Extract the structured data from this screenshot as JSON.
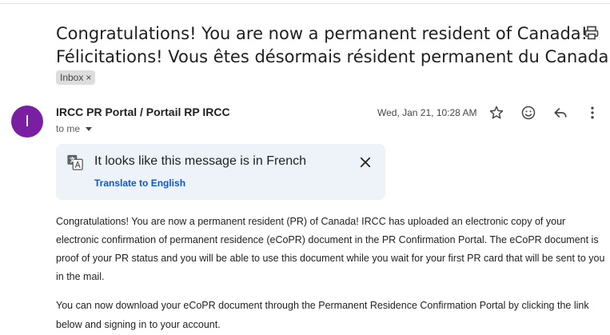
{
  "email": {
    "subject_en": "Congratulations! You are now a permanent resident of Canada!",
    "subject_fr": "Félicitations! Vous êtes désormais résident permanent du Canada!",
    "label": "Inbox",
    "label_remove": "×",
    "sender": {
      "initial": "I",
      "name": "IRCC PR Portal / Portail RP IRCC",
      "avatar_color": "#7b1fa2"
    },
    "recipient_line": "to me",
    "date": "Wed, Jan 21, 10:28 AM"
  },
  "toolbar_icons": [
    "print-icon",
    "star-icon",
    "emoji-icon",
    "reply-icon",
    "more-icon"
  ],
  "translate_banner": {
    "message": "It looks like this message is in French",
    "action": "Translate to English",
    "link_color": "#0b57d0"
  },
  "body": {
    "paragraphs": [
      "Congratulations! You are now a permanent resident (PR) of Canada! IRCC has uploaded an electronic copy of your electronic confirmation of permanent residence (eCoPR) document in the PR Confirmation Portal. The eCoPR document is proof of your PR status and you will be able to use this document while you wait for your first PR card that will be sent to you in the mail.",
      "You can now download your eCoPR document through the Permanent Residence Confirmation Portal by clicking the link below and signing in to your account."
    ]
  }
}
